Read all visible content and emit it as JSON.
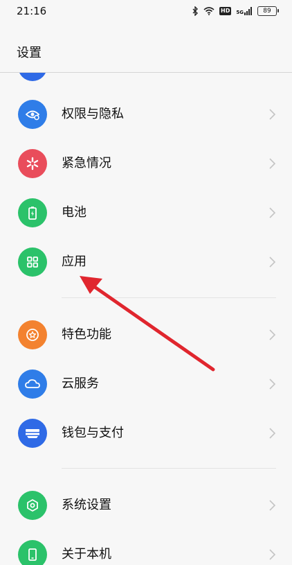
{
  "status_bar": {
    "time": "21:16",
    "hd": "HD",
    "signal": "5G",
    "battery": "89"
  },
  "header": {
    "title": "设置"
  },
  "items": [
    {
      "label": "权限与隐私",
      "color": "#2f7de8",
      "icon": "eye-shield-icon"
    },
    {
      "label": "紧急情况",
      "color": "#e94d5b",
      "icon": "asterisk-icon"
    },
    {
      "label": "电池",
      "color": "#2bc26a",
      "icon": "battery-icon"
    },
    {
      "label": "应用",
      "color": "#2bc26a",
      "icon": "app-grid-icon"
    },
    {
      "label": "特色功能",
      "color": "#f3822f",
      "icon": "star-badge-icon"
    },
    {
      "label": "云服务",
      "color": "#2f7de8",
      "icon": "cloud-icon"
    },
    {
      "label": "钱包与支付",
      "color": "#2f6ae6",
      "icon": "wallet-icon"
    },
    {
      "label": "系统设置",
      "color": "#2bc26a",
      "icon": "hexagon-gear-icon"
    },
    {
      "label": "关于本机",
      "color": "#2bc26a",
      "icon": "phone-icon"
    }
  ],
  "annotation": {
    "color": "#e0262e"
  }
}
